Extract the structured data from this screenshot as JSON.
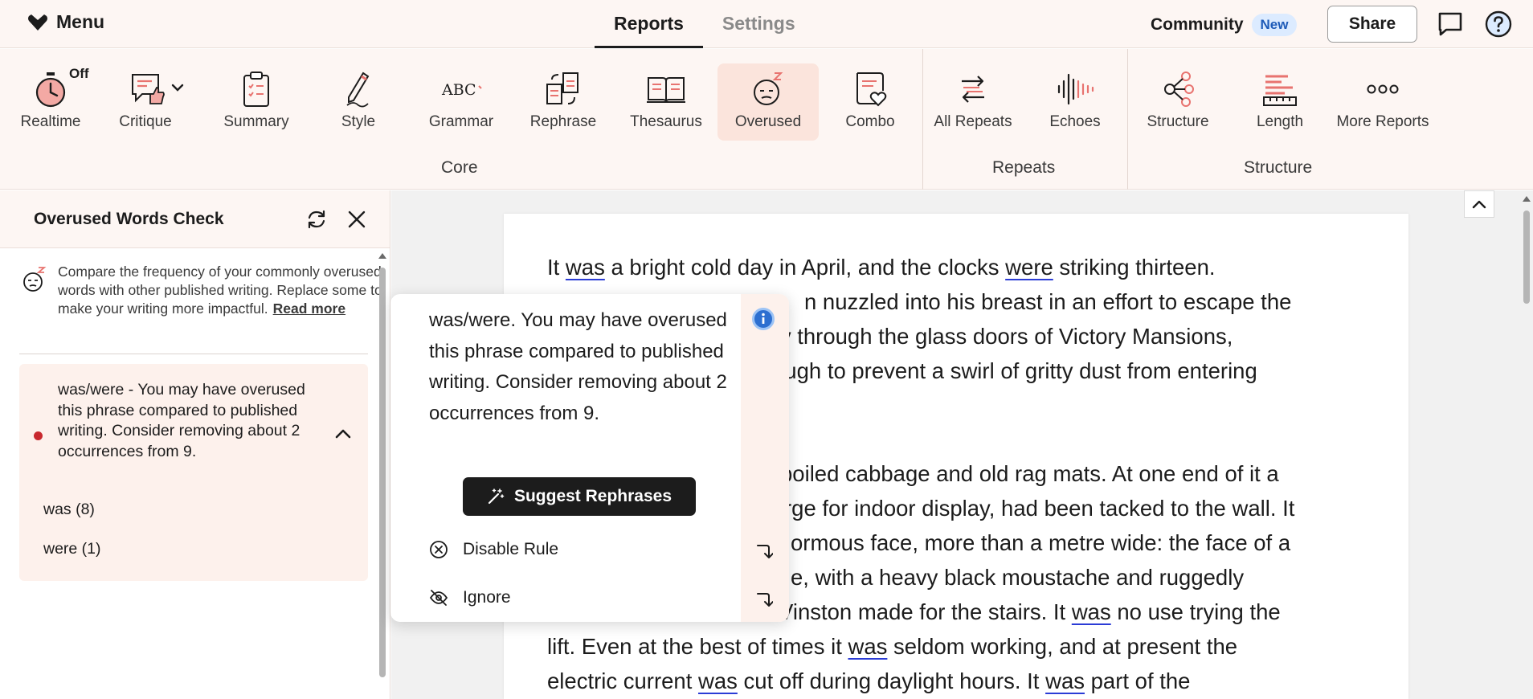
{
  "topbar": {
    "menu_label": "Menu",
    "tabs": [
      {
        "label": "Reports",
        "active": true
      },
      {
        "label": "Settings",
        "active": false
      }
    ],
    "community_label": "Community",
    "new_badge": "New",
    "share_label": "Share"
  },
  "ribbon": {
    "realtime_status": "Off",
    "buttons": {
      "realtime": "Realtime",
      "critique": "Critique",
      "summary": "Summary",
      "style": "Style",
      "grammar": "Grammar",
      "rephrase": "Rephrase",
      "thesaurus": "Thesaurus",
      "overused": "Overused",
      "combo": "Combo",
      "all_repeats": "All Repeats",
      "echoes": "Echoes",
      "structure": "Structure",
      "length": "Length",
      "more_reports": "More Reports"
    },
    "active_button": "overused",
    "groups": {
      "core": "Core",
      "repeats": "Repeats",
      "structure": "Structure"
    },
    "grammar_icon_text": "ABC"
  },
  "panel": {
    "title": "Overused Words Check",
    "intro": "Compare the frequency of your commonly overused words with other published writing. Replace some to make your writing more impactful.",
    "read_more": "Read more",
    "issue": {
      "text": "was/were - You may have overused this phrase compared to published writing. Consider removing about 2 occurrences from 9.",
      "words": [
        {
          "label": "was (8)"
        },
        {
          "label": "were (1)"
        }
      ]
    }
  },
  "editor": {
    "p1": {
      "l1": {
        "a": "It ",
        "b": "was",
        "c": " a bright cold day in April, and the clocks ",
        "d": "were",
        "e": " striking thirteen."
      },
      "l2": "n nuzzled into his breast in an effort to escape the",
      "l3": "kly through the glass doors of Victory Mansions,",
      "l4": "ough to prevent a swirl of gritty dust from entering"
    },
    "p2": {
      "l1": "boiled cabbage and old rag mats. At one end of it a",
      "l2": "rge for indoor display, had been tacked to the wall. It",
      "l3": "ormous face, more than a metre wide: the face of a",
      "l4": "e, with a heavy black moustache and ruggedly",
      "l5": {
        "a": "Vinston made for the stairs. It ",
        "b": "was",
        "c": " no use trying the"
      },
      "l6": {
        "a": "lift. Even at the best of times it ",
        "b": "was",
        "c": " seldom working, and at present the"
      },
      "l7": {
        "a": "electric current ",
        "b": "was",
        "c": " cut off during daylight hours. It ",
        "d": "was",
        "e": " part of the"
      }
    }
  },
  "popup": {
    "text": "was/were. You may have overused this phrase compared to published writing. Consider removing about 2 occurrences from 9.",
    "suggest_label": "Suggest Rephrases",
    "disable_label": "Disable Rule",
    "ignore_label": "Ignore"
  },
  "colors": {
    "accent_red": "#e8736f",
    "underline_blue": "#2b3cd6",
    "issue_dot": "#c8282e",
    "ribbon_bg": "#fdf6f3",
    "active_bg": "#fbe4dc",
    "new_badge_bg": "#dcebff"
  }
}
